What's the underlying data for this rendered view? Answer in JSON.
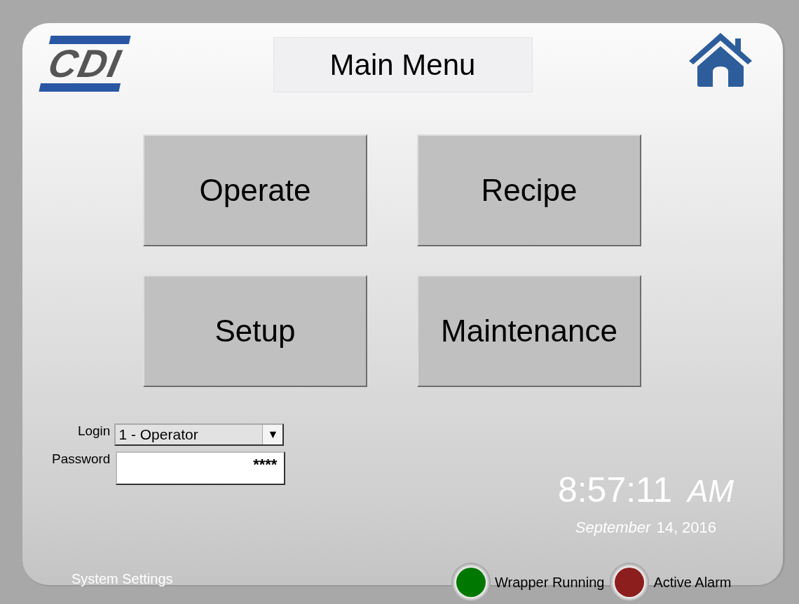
{
  "logo": {
    "text": "CDI"
  },
  "title": "Main Menu",
  "menu_buttons": [
    {
      "label": "Operate"
    },
    {
      "label": "Recipe"
    },
    {
      "label": "Setup"
    },
    {
      "label": "Maintenance"
    }
  ],
  "login": {
    "label": "Login",
    "value": "1 - Operator",
    "arrow": "▼"
  },
  "password": {
    "label": "Password",
    "value": "****"
  },
  "clock": {
    "time": "8:57:11",
    "meridiem": "AM",
    "month": "September",
    "day_year": "14, 2016"
  },
  "system_settings": "System Settings",
  "indicators": [
    {
      "label": "Wrapper Running",
      "color": "#007800"
    },
    {
      "label": "Active Alarm",
      "color": "#8c1e1e"
    }
  ]
}
